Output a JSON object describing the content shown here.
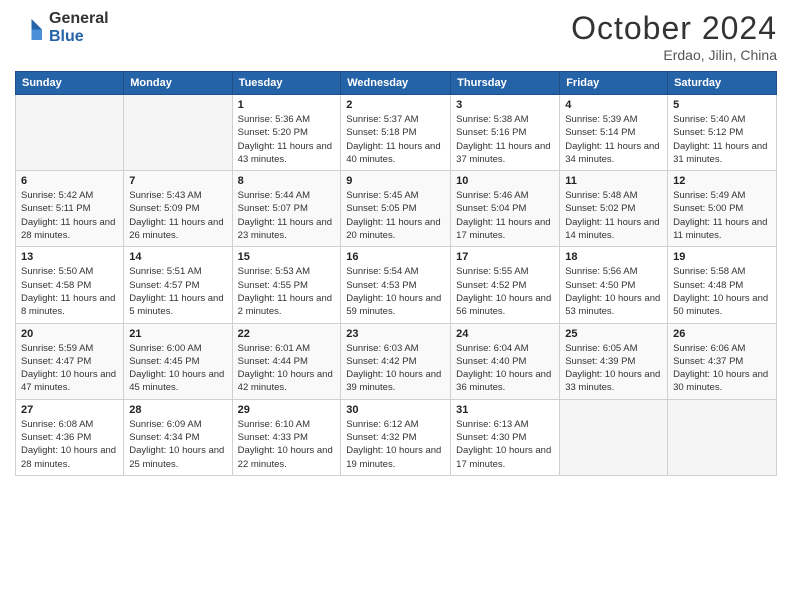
{
  "header": {
    "logo_general": "General",
    "logo_blue": "Blue",
    "month_title": "October 2024",
    "location": "Erdao, Jilin, China"
  },
  "days_of_week": [
    "Sunday",
    "Monday",
    "Tuesday",
    "Wednesday",
    "Thursday",
    "Friday",
    "Saturday"
  ],
  "weeks": [
    [
      {
        "day": "",
        "info": ""
      },
      {
        "day": "",
        "info": ""
      },
      {
        "day": "1",
        "info": "Sunrise: 5:36 AM\nSunset: 5:20 PM\nDaylight: 11 hours and 43 minutes."
      },
      {
        "day": "2",
        "info": "Sunrise: 5:37 AM\nSunset: 5:18 PM\nDaylight: 11 hours and 40 minutes."
      },
      {
        "day": "3",
        "info": "Sunrise: 5:38 AM\nSunset: 5:16 PM\nDaylight: 11 hours and 37 minutes."
      },
      {
        "day": "4",
        "info": "Sunrise: 5:39 AM\nSunset: 5:14 PM\nDaylight: 11 hours and 34 minutes."
      },
      {
        "day": "5",
        "info": "Sunrise: 5:40 AM\nSunset: 5:12 PM\nDaylight: 11 hours and 31 minutes."
      }
    ],
    [
      {
        "day": "6",
        "info": "Sunrise: 5:42 AM\nSunset: 5:11 PM\nDaylight: 11 hours and 28 minutes."
      },
      {
        "day": "7",
        "info": "Sunrise: 5:43 AM\nSunset: 5:09 PM\nDaylight: 11 hours and 26 minutes."
      },
      {
        "day": "8",
        "info": "Sunrise: 5:44 AM\nSunset: 5:07 PM\nDaylight: 11 hours and 23 minutes."
      },
      {
        "day": "9",
        "info": "Sunrise: 5:45 AM\nSunset: 5:05 PM\nDaylight: 11 hours and 20 minutes."
      },
      {
        "day": "10",
        "info": "Sunrise: 5:46 AM\nSunset: 5:04 PM\nDaylight: 11 hours and 17 minutes."
      },
      {
        "day": "11",
        "info": "Sunrise: 5:48 AM\nSunset: 5:02 PM\nDaylight: 11 hours and 14 minutes."
      },
      {
        "day": "12",
        "info": "Sunrise: 5:49 AM\nSunset: 5:00 PM\nDaylight: 11 hours and 11 minutes."
      }
    ],
    [
      {
        "day": "13",
        "info": "Sunrise: 5:50 AM\nSunset: 4:58 PM\nDaylight: 11 hours and 8 minutes."
      },
      {
        "day": "14",
        "info": "Sunrise: 5:51 AM\nSunset: 4:57 PM\nDaylight: 11 hours and 5 minutes."
      },
      {
        "day": "15",
        "info": "Sunrise: 5:53 AM\nSunset: 4:55 PM\nDaylight: 11 hours and 2 minutes."
      },
      {
        "day": "16",
        "info": "Sunrise: 5:54 AM\nSunset: 4:53 PM\nDaylight: 10 hours and 59 minutes."
      },
      {
        "day": "17",
        "info": "Sunrise: 5:55 AM\nSunset: 4:52 PM\nDaylight: 10 hours and 56 minutes."
      },
      {
        "day": "18",
        "info": "Sunrise: 5:56 AM\nSunset: 4:50 PM\nDaylight: 10 hours and 53 minutes."
      },
      {
        "day": "19",
        "info": "Sunrise: 5:58 AM\nSunset: 4:48 PM\nDaylight: 10 hours and 50 minutes."
      }
    ],
    [
      {
        "day": "20",
        "info": "Sunrise: 5:59 AM\nSunset: 4:47 PM\nDaylight: 10 hours and 47 minutes."
      },
      {
        "day": "21",
        "info": "Sunrise: 6:00 AM\nSunset: 4:45 PM\nDaylight: 10 hours and 45 minutes."
      },
      {
        "day": "22",
        "info": "Sunrise: 6:01 AM\nSunset: 4:44 PM\nDaylight: 10 hours and 42 minutes."
      },
      {
        "day": "23",
        "info": "Sunrise: 6:03 AM\nSunset: 4:42 PM\nDaylight: 10 hours and 39 minutes."
      },
      {
        "day": "24",
        "info": "Sunrise: 6:04 AM\nSunset: 4:40 PM\nDaylight: 10 hours and 36 minutes."
      },
      {
        "day": "25",
        "info": "Sunrise: 6:05 AM\nSunset: 4:39 PM\nDaylight: 10 hours and 33 minutes."
      },
      {
        "day": "26",
        "info": "Sunrise: 6:06 AM\nSunset: 4:37 PM\nDaylight: 10 hours and 30 minutes."
      }
    ],
    [
      {
        "day": "27",
        "info": "Sunrise: 6:08 AM\nSunset: 4:36 PM\nDaylight: 10 hours and 28 minutes."
      },
      {
        "day": "28",
        "info": "Sunrise: 6:09 AM\nSunset: 4:34 PM\nDaylight: 10 hours and 25 minutes."
      },
      {
        "day": "29",
        "info": "Sunrise: 6:10 AM\nSunset: 4:33 PM\nDaylight: 10 hours and 22 minutes."
      },
      {
        "day": "30",
        "info": "Sunrise: 6:12 AM\nSunset: 4:32 PM\nDaylight: 10 hours and 19 minutes."
      },
      {
        "day": "31",
        "info": "Sunrise: 6:13 AM\nSunset: 4:30 PM\nDaylight: 10 hours and 17 minutes."
      },
      {
        "day": "",
        "info": ""
      },
      {
        "day": "",
        "info": ""
      }
    ]
  ]
}
